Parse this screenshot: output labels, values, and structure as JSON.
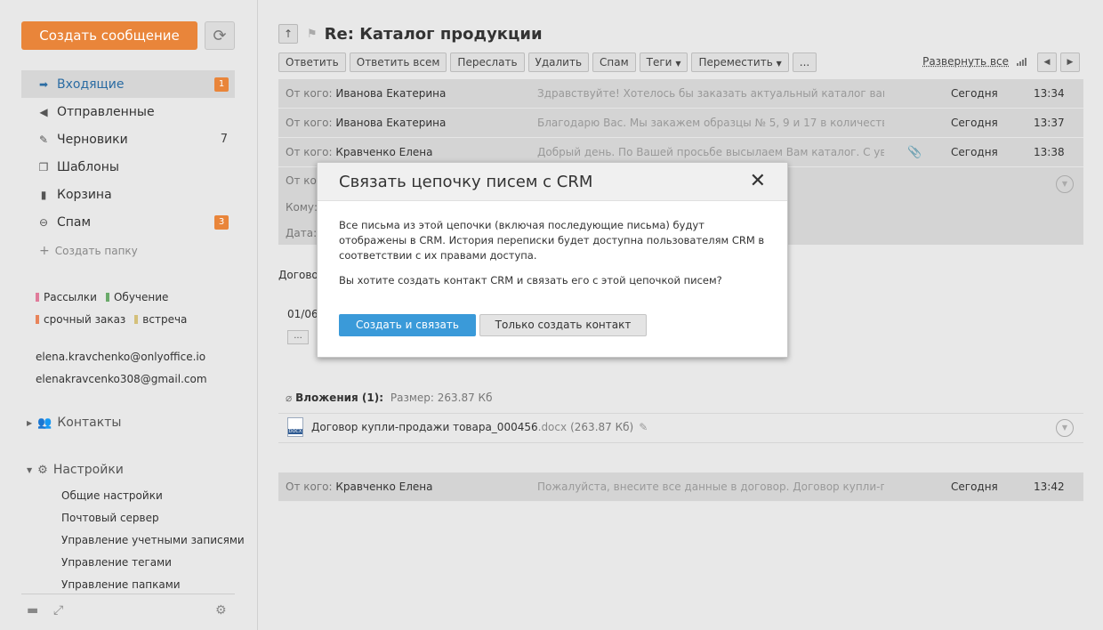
{
  "sidebar": {
    "create_label": "Создать сообщение",
    "folders": [
      {
        "label": "Входящие",
        "badge": "1"
      },
      {
        "label": "Отправленные"
      },
      {
        "label": "Черновики",
        "count": "7"
      },
      {
        "label": "Шаблоны"
      },
      {
        "label": "Корзина"
      },
      {
        "label": "Спам",
        "badge": "3"
      }
    ],
    "create_folder_label": "Создать папку",
    "tags": [
      {
        "label": "Рассылки",
        "color": "#e07b9a"
      },
      {
        "label": "Обучение",
        "color": "#6aaa6a"
      },
      {
        "label": "срочный заказ",
        "color": "#e8845a"
      },
      {
        "label": "встреча",
        "color": "#d4c07a"
      }
    ],
    "accounts": [
      "elena.kravchenko@onlyoffice.io",
      "elenakravcenko308@gmail.com"
    ],
    "contacts_label": "Контакты",
    "settings_label": "Настройки",
    "settings_items": [
      "Общие настройки",
      "Почтовый сервер",
      "Управление учетными записями",
      "Управление тегами",
      "Управление папками"
    ]
  },
  "thread": {
    "subject": "Re: Каталог продукции",
    "toolbar": [
      "Ответить",
      "Ответить всем",
      "Переслать",
      "Удалить",
      "Спам",
      "Теги",
      "Переместить",
      "..."
    ],
    "expand_all": "Развернуть все",
    "from_label": "От кого:",
    "messages": [
      {
        "from": "Иванова Екатерина",
        "preview": "Здравствуйте! Хотелось бы заказать актуальный каталог вашей...",
        "date": "Сегодня",
        "time": "13:34"
      },
      {
        "from": "Иванова Екатерина",
        "preview": "Благодарю Вас. Мы закажем образцы № 5, 9 и 17 в количестве ...",
        "date": "Сегодня",
        "time": "13:37"
      },
      {
        "from": "Кравченко Елена",
        "preview": "Добрый день. По Вашей просьбе высылаем Вам каталог. С ува...",
        "date": "Сегодня",
        "time": "13:38"
      }
    ],
    "expanded": {
      "from_label": "От ко",
      "to_label": "Кому:",
      "date_label": "Дата:"
    },
    "body_text": "Догово",
    "body_date": "01/06",
    "dots": "...",
    "attachments_title": "Вложения (1):",
    "attachments_size": "Размер: 263.87 Кб",
    "attachment": {
      "name": "Договор купли-продажи товара_000456",
      "ext": ".docx",
      "size": "(263.87 Кб)",
      "icon_text": "DOCX"
    },
    "last_message": {
      "from": "Кравченко Елена",
      "preview": "Пожалуйста, внесите все данные в договор. Договор купли-про...",
      "date": "Сегодня",
      "time": "13:42"
    }
  },
  "modal": {
    "title": "Связать цепочку писем с CRM",
    "body": "Все письма из этой цепочки (включая последующие письма) будут отображены в CRM. История переписки будет доступна пользователям CRM в соответствии с их правами доступа.",
    "question": "Вы хотите создать контакт CRM и связать его с этой цепочкой писем?",
    "primary_label": "Создать и связать",
    "secondary_label": "Только создать контакт"
  }
}
